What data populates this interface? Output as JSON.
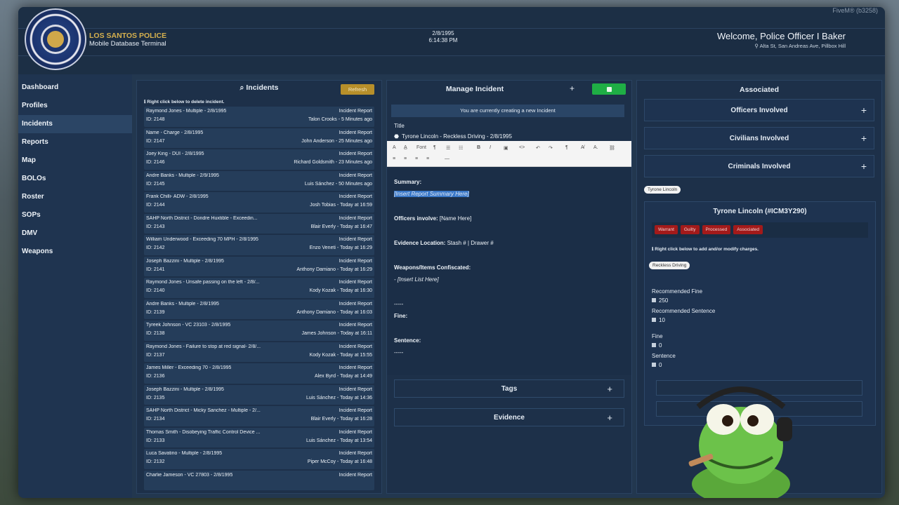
{
  "header": {
    "org_name": "LOS SANTOS POLICE",
    "subtitle": "Mobile Database Terminal",
    "date": "2/8/1995",
    "time": "6:14:38 PM",
    "welcome": "Welcome, Police Officer I Baker",
    "location": "Alta St, San Andreas Ave, Pillbox Hill",
    "overlay_text": "FiveM® (b3258)"
  },
  "sidebar": {
    "items": [
      {
        "label": "Dashboard"
      },
      {
        "label": "Profiles"
      },
      {
        "label": "Incidents",
        "active": true
      },
      {
        "label": "Reports"
      },
      {
        "label": "Map"
      },
      {
        "label": "BOLOs"
      },
      {
        "label": "Roster"
      },
      {
        "label": "SOPs"
      },
      {
        "label": "DMV"
      },
      {
        "label": "Weapons"
      }
    ]
  },
  "incidents": {
    "title": "Incidents",
    "refresh_label": "Refresh",
    "hint": "ℹ Right click below to delete incident.",
    "rows": [
      {
        "title": "Raymond Jones - Multiple - 2/8/1995",
        "id": "ID: 2148",
        "type": "Incident Report",
        "meta": "Talon Crooks - 5 Minutes ago"
      },
      {
        "title": "Name - Charge - 2/8/1995",
        "id": "ID: 2147",
        "type": "Incident Report",
        "meta": "John Anderson - 25 Minutes ago"
      },
      {
        "title": "Joey King - DUI - 2/8/1995",
        "id": "ID: 2146",
        "type": "Incident Report",
        "meta": "Richard Goldsmith - 23 Minutes ago"
      },
      {
        "title": "Andre Banks - Multiple - 2/9/1995",
        "id": "ID: 2145",
        "type": "Incident Report",
        "meta": "Luis Sánchez - 50 Minutes ago"
      },
      {
        "title": "Frank Chilli- ADW - 2/8/1995",
        "id": "ID: 2144",
        "type": "Incident Report",
        "meta": "Josh Tobias - Today at 16:59"
      },
      {
        "title": "SAHP North District - Dondre Huxtible - Exceedin...",
        "id": "ID: 2143",
        "type": "Incident Report",
        "meta": "Blair Everly - Today at 16:47"
      },
      {
        "title": "William Underwood - Exceeding 70 MPH - 2/8/1995",
        "id": "ID: 2142",
        "type": "Incident Report",
        "meta": "Enzo Veneti - Today at 16:29"
      },
      {
        "title": "Joseph Bazzini - Multiple - 2/8/1995",
        "id": "ID: 2141",
        "type": "Incident Report",
        "meta": "Anthony Damiano - Today at 16:29"
      },
      {
        "title": "Raymond Jones - Unsafe passing on the left - 2/8/...",
        "id": "ID: 2140",
        "type": "Incident Report",
        "meta": "Kody Kozak - Today at 16:30"
      },
      {
        "title": "Andre Banks - Multiple - 2/8/1995",
        "id": "ID: 2139",
        "type": "Incident Report",
        "meta": "Anthony Damiano - Today at 16:03"
      },
      {
        "title": "Tyreek Johnson - VC 23103 - 2/8/1995",
        "id": "ID: 2138",
        "type": "Incident Report",
        "meta": "James Johnson - Today at 16:11"
      },
      {
        "title": "Raymond Jones - Failure to stop at red signal- 2/8/...",
        "id": "ID: 2137",
        "type": "Incident Report",
        "meta": "Kody Kozak - Today at 15:55"
      },
      {
        "title": "James Miller - Exceeding 70 - 2/8/1995",
        "id": "ID: 2136",
        "type": "Incident Report",
        "meta": "Alex Byrd - Today at 14:49"
      },
      {
        "title": "Joseph Bazzini - Multiple - 2/8/1995",
        "id": "ID: 2135",
        "type": "Incident Report",
        "meta": "Luis Sánchez - Today at 14:36"
      },
      {
        "title": "SAHP North District - Micky Sanchez - Multiple - 2/...",
        "id": "ID: 2134",
        "type": "Incident Report",
        "meta": "Blair Everly - Today at 16:28"
      },
      {
        "title": "Thomas Smith - Disobeying Traffic Control Device ...",
        "id": "ID: 2133",
        "type": "Incident Report",
        "meta": "Luis Sánchez - Today at 13:54"
      },
      {
        "title": "Luca Savatino - Multiple - 2/8/1995",
        "id": "ID: 2132",
        "type": "Incident Report",
        "meta": "Piper McCoy - Today at 16:48"
      },
      {
        "title": "Charlie Jameson - VC 27803 - 2/8/1995",
        "id": "",
        "type": "Incident Report",
        "meta": ""
      }
    ]
  },
  "manage": {
    "title": "Manage Incident",
    "creating_notice": "You are currently creating a new Incident",
    "title_label": "Title",
    "title_value": "Tyrone Lincoln  - Reckless Driving - 2/8/1995",
    "font_label": "Font",
    "summary_label": "Summary:",
    "summary_value": "[Insert Report Summary Here]",
    "officers_label": "Officers involve:",
    "officers_value": " [Name Here]",
    "evidence_label": "Evidence Location:",
    "evidence_value": " Stash # | Drawer #",
    "weapons_label": "Weapons/Items Confiscated:",
    "weapons_value": "- [Insert List Here]",
    "divider1": "-----",
    "fine_label": "Fine:",
    "sentence_label": "Sentence:",
    "divider2": "-----",
    "tags_label": "Tags",
    "evidence_section_label": "Evidence"
  },
  "associated": {
    "title": "Associated",
    "sections": [
      {
        "label": "Officers Involved"
      },
      {
        "label": "Civilians Involved"
      },
      {
        "label": "Criminals Involved"
      }
    ],
    "criminal_pill": "Tyrone Lincoln",
    "criminal_name": "Tyrone Lincoln (#ICM3Y290)",
    "tags": [
      "Warrant",
      "Guilty",
      "Processed",
      "Associated"
    ],
    "hint": "ℹ Right click below to add and/or modify charges.",
    "charge_pill": "Reckless Driving",
    "recommended_fine_label": "Recommended Fine",
    "recommended_fine_value": "250",
    "recommended_sentence_label": "Recommended Sentence",
    "recommended_sentence_value": "10",
    "fine_label": "Fine",
    "fine_value": "0",
    "sentence_label": "Sentence",
    "sentence_value": "0"
  },
  "colors": {
    "accent_gold": "#b78f2a",
    "save_green": "#1fae45",
    "tag_red": "#a31a1a",
    "panel_bg": "#1d3049"
  }
}
